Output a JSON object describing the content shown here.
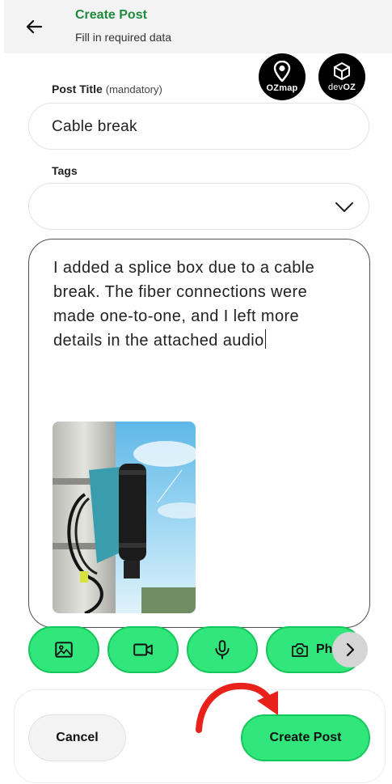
{
  "header": {
    "title": "Create Post",
    "subtitle": "Fill in required data",
    "back_icon": "arrow-left-icon"
  },
  "logos": {
    "ozmap": "OZmap",
    "devoz_prefix": "dev",
    "devoz_suffix": "OZ"
  },
  "form": {
    "post_title": {
      "label": "Post Title",
      "hint": "(mandatory)",
      "value": "Cable break"
    },
    "tags": {
      "label": "Tags",
      "value": ""
    },
    "description": {
      "value": "I added a splice box due to a cable break. The fiber connections were made one-to-one, and I left more details in the attached audio"
    }
  },
  "media_buttons": [
    {
      "icon": "image-icon"
    },
    {
      "icon": "video-icon"
    },
    {
      "icon": "microphone-icon"
    },
    {
      "icon": "camera-icon",
      "label": "Ph"
    }
  ],
  "footer": {
    "cancel_label": "Cancel",
    "create_label": "Create Post"
  },
  "colors": {
    "accent": "#31e67a",
    "accent_border": "#14c75c",
    "title_green": "#1f8a3d",
    "annotation_red": "#e8221b"
  }
}
